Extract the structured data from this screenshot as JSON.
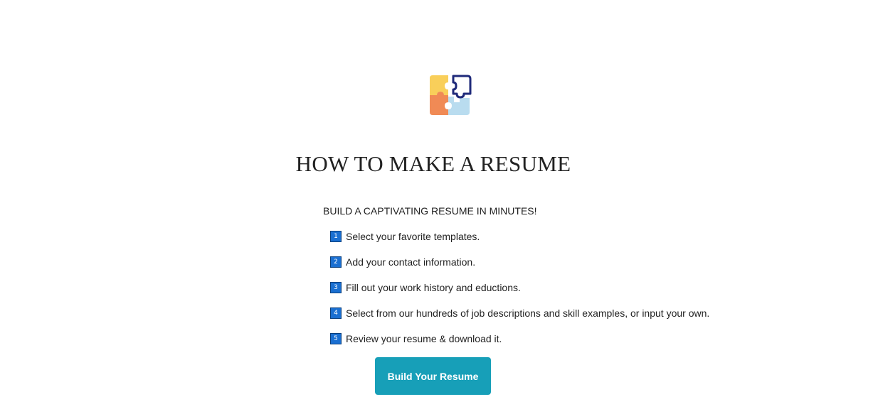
{
  "logo": {
    "icon": "puzzle-pieces-icon",
    "colors": {
      "yellow": "#f9cf5a",
      "orange": "#f08a55",
      "light_blue": "#b9dcef",
      "outline": "#1f2a7a"
    }
  },
  "title": "HOW TO MAKE A RESUME",
  "subtitle": "BUILD A CAPTIVATING RESUME IN MINUTES!",
  "steps": [
    {
      "num": "1",
      "text": "Select your favorite templates."
    },
    {
      "num": "2",
      "text": "Add your contact information."
    },
    {
      "num": "3",
      "text": "Fill out your work history and eductions."
    },
    {
      "num": "4",
      "text": "Select from our hundreds of job descriptions and skill examples, or input your own."
    },
    {
      "num": "5",
      "text": "Review your resume & download it."
    }
  ],
  "cta": {
    "label": "Build Your Resume",
    "color": "#179fb8"
  },
  "colors": {
    "badge": "#1a6fd1",
    "text": "#222222"
  }
}
